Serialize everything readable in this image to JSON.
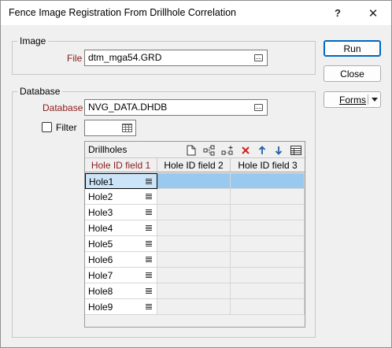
{
  "window": {
    "title": "Fence Image Registration From Drillhole Correlation",
    "help_glyph": "?",
    "close_glyph": "✕"
  },
  "image_group": {
    "legend": "Image",
    "file_label": "File",
    "file_value": "dtm_mga54.GRD"
  },
  "database_group": {
    "legend": "Database",
    "database_label": "Database",
    "database_value": "NVG_DATA.DHDB",
    "filter_label": "Filter",
    "filter_checked": false,
    "filter_value": ""
  },
  "buttons": {
    "run": "Run",
    "close": "Close",
    "forms": "Forms"
  },
  "grid": {
    "title": "Drillholes",
    "toolbar_icons": [
      "new-document-icon",
      "hierarchy-icon",
      "hierarchy-add-icon",
      "delete-icon",
      "move-up-icon",
      "move-down-icon",
      "table-options-icon"
    ],
    "columns": [
      "Hole ID field 1",
      "Hole ID field 2",
      "Hole ID field 3"
    ],
    "rows": [
      {
        "hole": "Hole1",
        "field2": "",
        "field3": ""
      },
      {
        "hole": "Hole2",
        "field2": "",
        "field3": ""
      },
      {
        "hole": "Hole3",
        "field2": "",
        "field3": ""
      },
      {
        "hole": "Hole4",
        "field2": "",
        "field3": ""
      },
      {
        "hole": "Hole5",
        "field2": "",
        "field3": ""
      },
      {
        "hole": "Hole6",
        "field2": "",
        "field3": ""
      },
      {
        "hole": "Hole7",
        "field2": "",
        "field3": ""
      },
      {
        "hole": "Hole8",
        "field2": "",
        "field3": ""
      },
      {
        "hole": "Hole9",
        "field2": "",
        "field3": ""
      }
    ],
    "selected_row": 0
  },
  "colors": {
    "required_label": "#8b1c1c",
    "selection": "#99c9ef",
    "primary_border": "#0067c0"
  }
}
